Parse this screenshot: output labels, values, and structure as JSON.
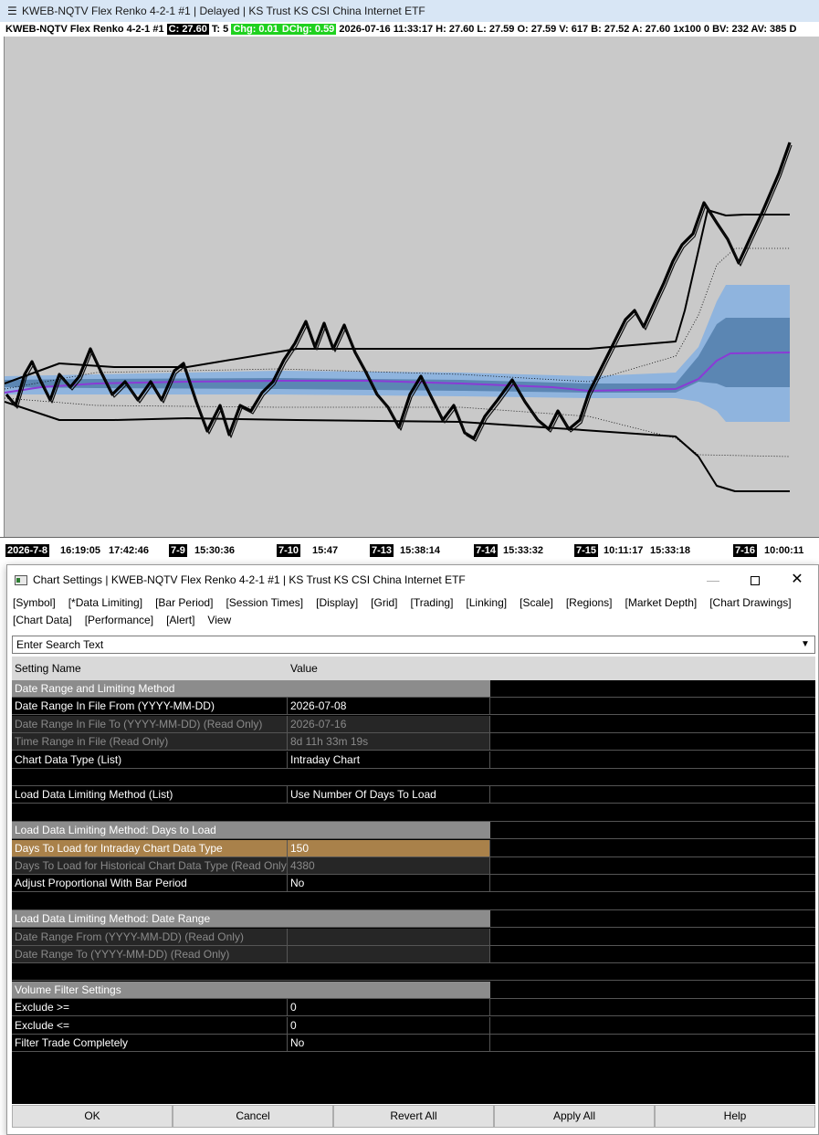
{
  "chart_window": {
    "title": "KWEB-NQTV  Flex Renko 4-2-1 #1 | Delayed | KS Trust KS CSI China Internet ETF",
    "header": {
      "symbol": "KWEB-NQTV  Flex Renko 4-2-1 #1",
      "close": "C: 27.60",
      "t": "T: 5",
      "chg": "Chg: 0.01",
      "dchg": "DChg: 0.59",
      "details": "2026-07-16 11:33:17 H: 27.60 L: 27.59 O: 27.59 V: 617 B: 27.52 A: 27.60 1x100 0 BV: 232 AV: 385 D"
    },
    "time_axis": [
      {
        "label": "2026-7-8",
        "type": "date"
      },
      {
        "label": "16:19:05",
        "type": "time"
      },
      {
        "label": "17:42:46",
        "type": "time"
      },
      {
        "label": "7-9",
        "type": "date"
      },
      {
        "label": "15:30:36",
        "type": "time"
      },
      {
        "label": "7-10",
        "type": "date"
      },
      {
        "label": "15:47",
        "type": "time"
      },
      {
        "label": "7-13",
        "type": "date"
      },
      {
        "label": "15:38:14",
        "type": "time"
      },
      {
        "label": "7-14",
        "type": "date"
      },
      {
        "label": "15:33:32",
        "type": "time"
      },
      {
        "label": "7-15",
        "type": "date"
      },
      {
        "label": "10:11:17",
        "type": "time"
      },
      {
        "label": "15:33:18",
        "type": "time"
      },
      {
        "label": "7-16",
        "type": "date"
      },
      {
        "label": "10:00:11",
        "type": "time"
      }
    ],
    "colors": {
      "background": "#c9c9c9",
      "price_line": "#000000",
      "midline": "#8a3bd6",
      "band_inner": "#5b86b3",
      "band_outer": "#8fb4de"
    }
  },
  "dialog": {
    "title": "Chart Settings | KWEB-NQTV  Flex Renko 4-2-1 #1 | KS Trust KS CSI China Internet ETF",
    "window_buttons": {
      "minimize": "—",
      "close": "✕"
    },
    "tabs": [
      "[Symbol]",
      "[*Data Limiting]",
      "[Bar Period]",
      "[Session Times]",
      "[Display]",
      "[Grid]",
      "[Trading]",
      "[Linking]",
      "[Scale]",
      "[Regions]",
      "[Market Depth]",
      "[Chart Drawings]",
      "[Chart Data]",
      "[Performance]",
      "[Alert]",
      "View"
    ],
    "search": {
      "placeholder": "Enter Search Text",
      "arrow": "▼"
    },
    "columns": {
      "name": "Setting Name",
      "value": "Value"
    },
    "rows": [
      {
        "kind": "section",
        "name": "Date Range and Limiting Method",
        "value": ""
      },
      {
        "kind": "normal",
        "name": "Date Range In File From (YYYY-MM-DD)",
        "value": "2026-07-08"
      },
      {
        "kind": "readonly",
        "name": "Date Range In File To (YYYY-MM-DD) (Read Only)",
        "value": "2026-07-16"
      },
      {
        "kind": "readonly",
        "name": "Time Range in File (Read Only)",
        "value": "8d 11h 33m 19s"
      },
      {
        "kind": "normal",
        "name": "Chart Data Type (List)",
        "value": "Intraday Chart"
      },
      {
        "kind": "blank",
        "name": "",
        "value": ""
      },
      {
        "kind": "normal",
        "name": "Load Data Limiting Method (List)",
        "value": "Use Number Of Days To Load"
      },
      {
        "kind": "blank",
        "name": "",
        "value": ""
      },
      {
        "kind": "section",
        "name": "Load Data Limiting Method: Days to Load",
        "value": ""
      },
      {
        "kind": "selected",
        "name": "Days To Load for Intraday Chart Data Type",
        "value": "150"
      },
      {
        "kind": "readonly",
        "name": "Days To Load for Historical Chart Data Type (Read Only)",
        "value": "4380"
      },
      {
        "kind": "normal",
        "name": "Adjust Proportional With Bar Period",
        "value": "No"
      },
      {
        "kind": "blank",
        "name": "",
        "value": ""
      },
      {
        "kind": "section",
        "name": "Load Data Limiting Method: Date Range",
        "value": ""
      },
      {
        "kind": "readonly",
        "name": "Date Range From (YYYY-MM-DD) (Read Only)",
        "value": ""
      },
      {
        "kind": "readonly",
        "name": "Date Range To (YYYY-MM-DD) (Read Only)",
        "value": ""
      },
      {
        "kind": "blank",
        "name": "",
        "value": ""
      },
      {
        "kind": "section",
        "name": "Volume Filter Settings",
        "value": ""
      },
      {
        "kind": "normal",
        "name": "Exclude >=",
        "value": "0"
      },
      {
        "kind": "normal",
        "name": "Exclude <=",
        "value": "0"
      },
      {
        "kind": "normal",
        "name": "Filter Trade Completely",
        "value": "No"
      }
    ],
    "buttons": [
      "OK",
      "Cancel",
      "Revert All",
      "Apply All",
      "Help"
    ]
  }
}
